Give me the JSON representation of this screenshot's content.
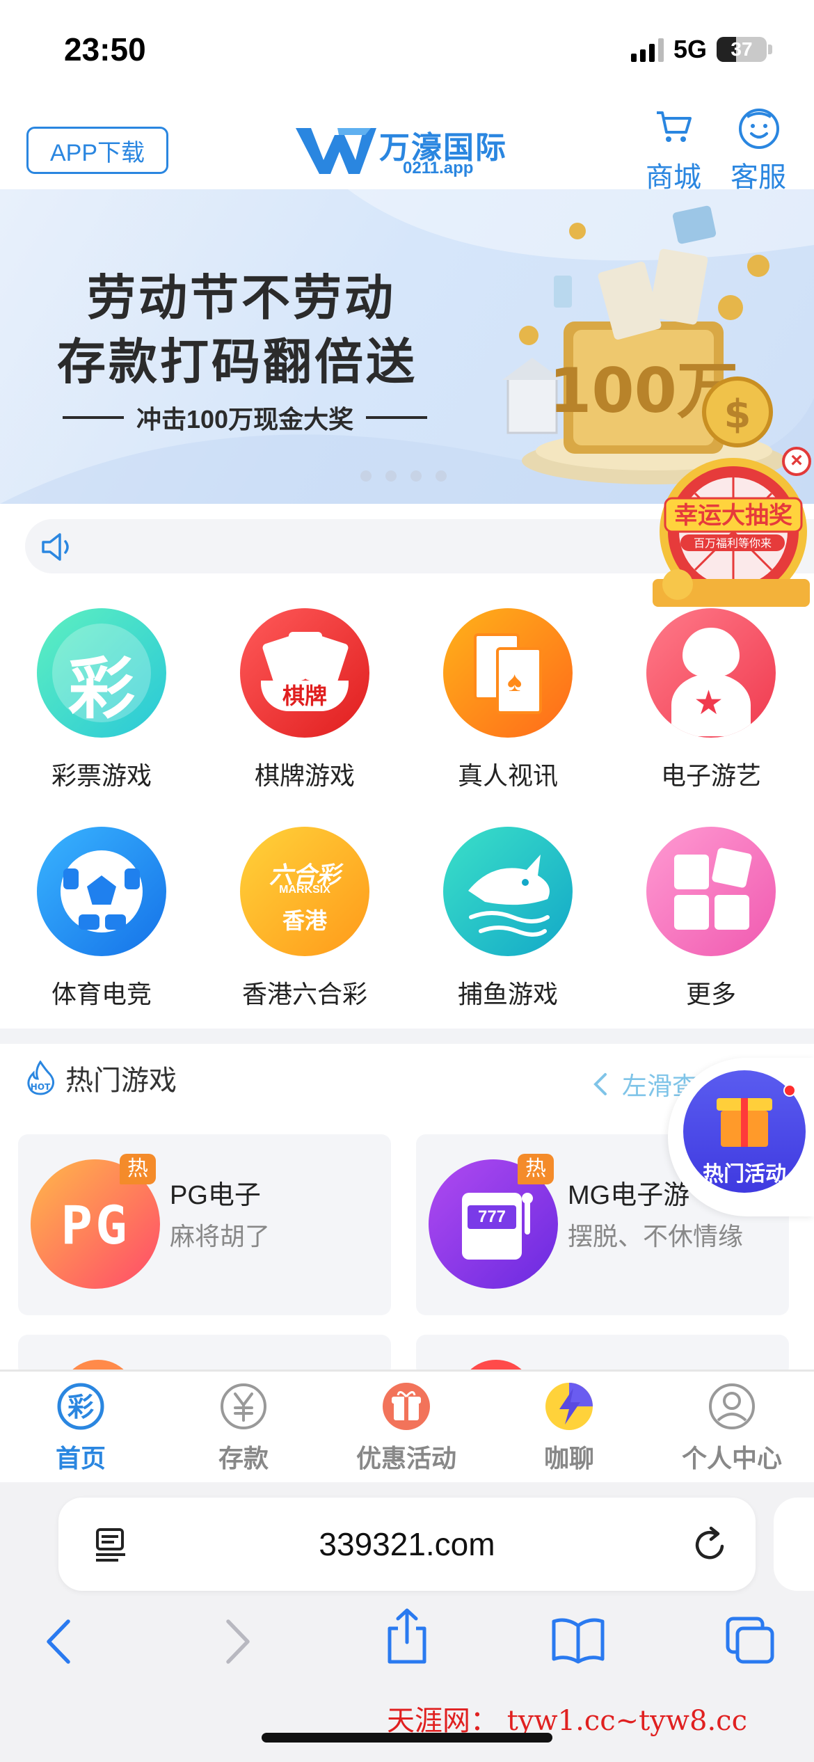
{
  "status": {
    "time": "23:50",
    "network": "5G",
    "battery": "37"
  },
  "header": {
    "app_download": "APP下载",
    "logo_name": "万濠国际",
    "logo_domain": "0211.app",
    "shop": "商城",
    "service": "客服"
  },
  "banner": {
    "line1": "劳动节不劳动",
    "line2": "存款打码翻倍送",
    "line3": "冲击100万现金大奖",
    "art_text": "100万",
    "slides": 4
  },
  "lucky": {
    "title": "幸运大抽奖",
    "sub": "百万福利等你来"
  },
  "categories": [
    {
      "label": "彩票游戏",
      "icon": "lottery-icon"
    },
    {
      "label": "棋牌游戏",
      "icon": "cards-icon",
      "icon_text": "棋牌"
    },
    {
      "label": "真人视讯",
      "icon": "live-casino-icon"
    },
    {
      "label": "电子游艺",
      "icon": "devil-icon"
    },
    {
      "label": "体育电竞",
      "icon": "soccer-icon"
    },
    {
      "label": "香港六合彩",
      "icon": "marksix-icon",
      "icon_text": "香港"
    },
    {
      "label": "捕鱼游戏",
      "icon": "shark-icon"
    },
    {
      "label": "更多",
      "icon": "more-icon"
    }
  ],
  "hot": {
    "title": "热门游戏",
    "more": "左滑查",
    "badge": "热",
    "games": [
      {
        "name": "PG电子",
        "desc": "麻将胡了",
        "icon_text": "PG"
      },
      {
        "name": "MG电子游",
        "desc": "摆脱、不休情缘",
        "icon_text": "777"
      }
    ]
  },
  "hot_activity": {
    "label": "热门活动"
  },
  "tabbar": [
    {
      "label": "首页",
      "active": true
    },
    {
      "label": "存款",
      "active": false
    },
    {
      "label": "优惠活动",
      "active": false
    },
    {
      "label": "咖聊",
      "active": false
    },
    {
      "label": "个人中心",
      "active": false
    }
  ],
  "safari": {
    "url": "339321.com"
  },
  "watermark": "天涯网： tyw1.cc~tyw8.cc",
  "colors": {
    "accent": "#2a86e0",
    "hot_badge": "#f48b2a",
    "watermark": "#e02020"
  }
}
